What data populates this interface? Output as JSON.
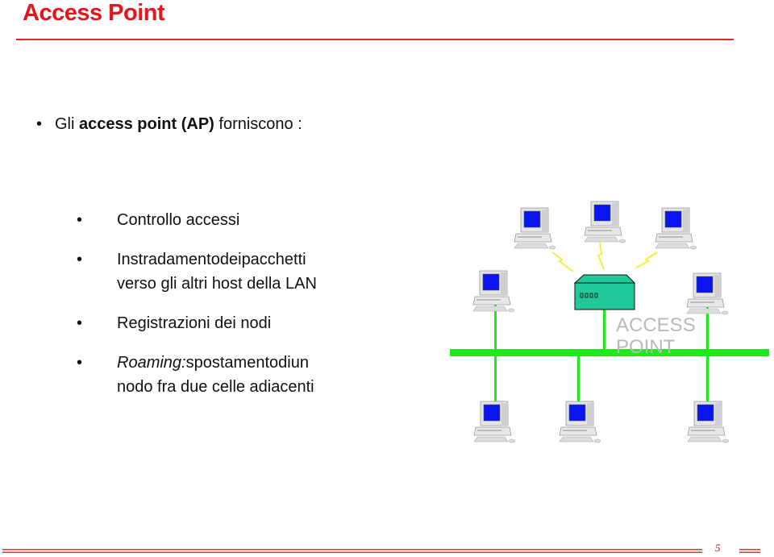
{
  "slide": {
    "title": "Access Point",
    "page_number": "5",
    "colors": {
      "title": "#e8141c",
      "lan": "#1ee81e",
      "access_point": "#20c997",
      "wireless": "#f2f23a",
      "label": "#b9b9b9"
    }
  },
  "lead": {
    "bullet": "•",
    "prefix": "Gli ",
    "bold": "access point (AP)",
    "suffix": " forniscono :"
  },
  "functions": [
    {
      "lines": [
        [
          "Controllo accessi"
        ]
      ]
    },
    {
      "lines": [
        [
          "Instradamento",
          "dei",
          "pacchetti"
        ],
        [
          "verso gli altri host della LAN"
        ]
      ]
    },
    {
      "lines": [
        [
          "Registrazioni dei nodi"
        ]
      ]
    },
    {
      "italic": "Roaming:",
      "lines": [
        [
          "spostamento",
          "di",
          "un"
        ],
        [
          "nodo fra due celle adiacenti"
        ]
      ]
    }
  ],
  "diagram": {
    "access_point_label_line1": "ACCESS",
    "access_point_label_line2": "POINT",
    "wireless_hosts": [
      "host-wireless-1",
      "host-wireless-2",
      "host-wireless-3"
    ],
    "wired_hosts": [
      "host-wired-top-left",
      "host-wired-top-right",
      "host-wired-bottom-1",
      "host-wired-bottom-2",
      "host-wired-bottom-3"
    ]
  }
}
